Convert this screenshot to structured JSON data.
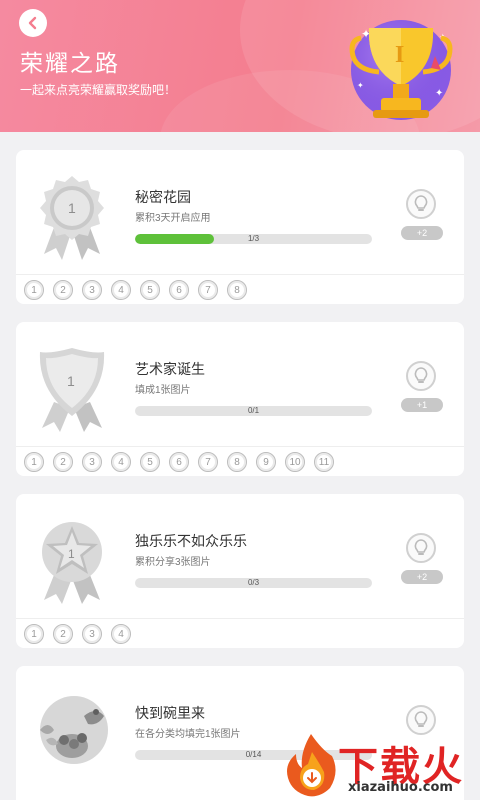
{
  "header": {
    "title": "荣耀之路",
    "subtitle": "一起来点亮荣耀赢取奖励吧！",
    "trophy_label": "I"
  },
  "achievements": [
    {
      "name": "秘密花园",
      "desc": "累积3天开启应用",
      "progress_text": "1/3",
      "progress": 0.333,
      "bonus": "+2",
      "medal_label": "1",
      "medal_shape": "rosette",
      "levels": [
        "1",
        "2",
        "3",
        "4",
        "5",
        "6",
        "7",
        "8"
      ]
    },
    {
      "name": "艺术家诞生",
      "desc": "填成1张图片",
      "progress_text": "0/1",
      "progress": 0,
      "bonus": "+1",
      "medal_label": "1",
      "medal_shape": "shield",
      "levels": [
        "1",
        "2",
        "3",
        "4",
        "5",
        "6",
        "7",
        "8",
        "9",
        "10",
        "11"
      ]
    },
    {
      "name": "独乐乐不如众乐乐",
      "desc": "累积分享3张图片",
      "progress_text": "0/3",
      "progress": 0,
      "bonus": "+2",
      "medal_label": "1",
      "medal_shape": "star",
      "levels": [
        "1",
        "2",
        "3",
        "4"
      ]
    },
    {
      "name": "快到碗里来",
      "desc": "在各分类均填完1张图片",
      "progress_text": "0/14",
      "progress": 0,
      "bonus": "",
      "medal_label": "",
      "medal_shape": "bowl",
      "levels": []
    }
  ],
  "watermark": {
    "big": "下载火",
    "small": "xiazaihuo.com"
  },
  "colors": {
    "header": "#f47d8e",
    "progress_fill": "#5ec13a",
    "watermark": "#e02424"
  },
  "icons": {
    "back": "chevron-left-icon",
    "reward": "lightbulb-icon",
    "trophy": "trophy-icon"
  }
}
